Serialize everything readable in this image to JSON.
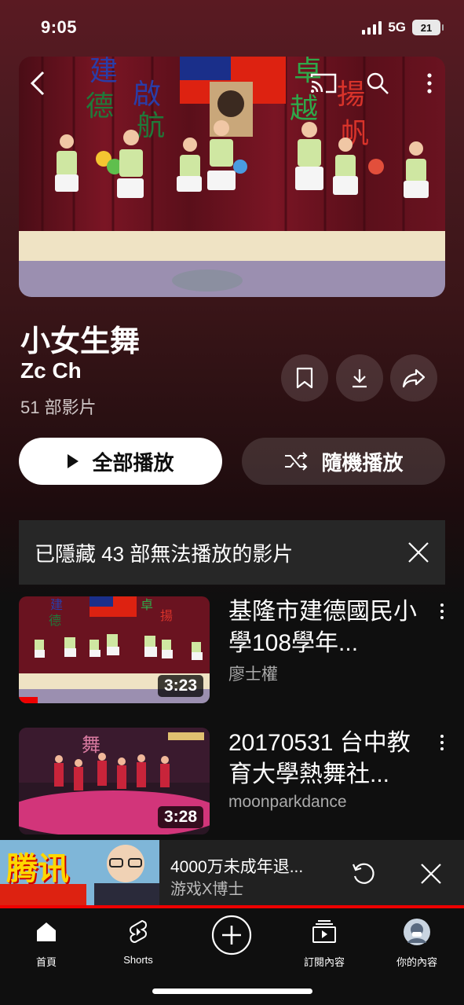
{
  "status": {
    "time": "9:05",
    "network": "5G",
    "battery": "21"
  },
  "playlist": {
    "title": "小女生舞",
    "channel": "Zc Ch",
    "video_count": "51 部影片",
    "play_all_label": "全部播放",
    "shuffle_label": "隨機播放",
    "hidden_notice": "已隱藏 43 部無法播放的影片"
  },
  "videos": [
    {
      "title": "基隆市建德國民小學108學年...",
      "channel": "廖士權",
      "duration": "3:23"
    },
    {
      "title": "20170531 台中教育大學熱舞社...",
      "channel": "moonparkdance",
      "duration": "3:28"
    }
  ],
  "mini_player": {
    "title": "4000万未成年退...",
    "channel": "游戏X博士",
    "thumb_text": "腾讯"
  },
  "nav": {
    "home": "首頁",
    "shorts": "Shorts",
    "subscriptions": "訂閱內容",
    "you": "你的內容"
  },
  "colors": {
    "accent_red": "#ee0000",
    "background": "#0f0f0f"
  }
}
